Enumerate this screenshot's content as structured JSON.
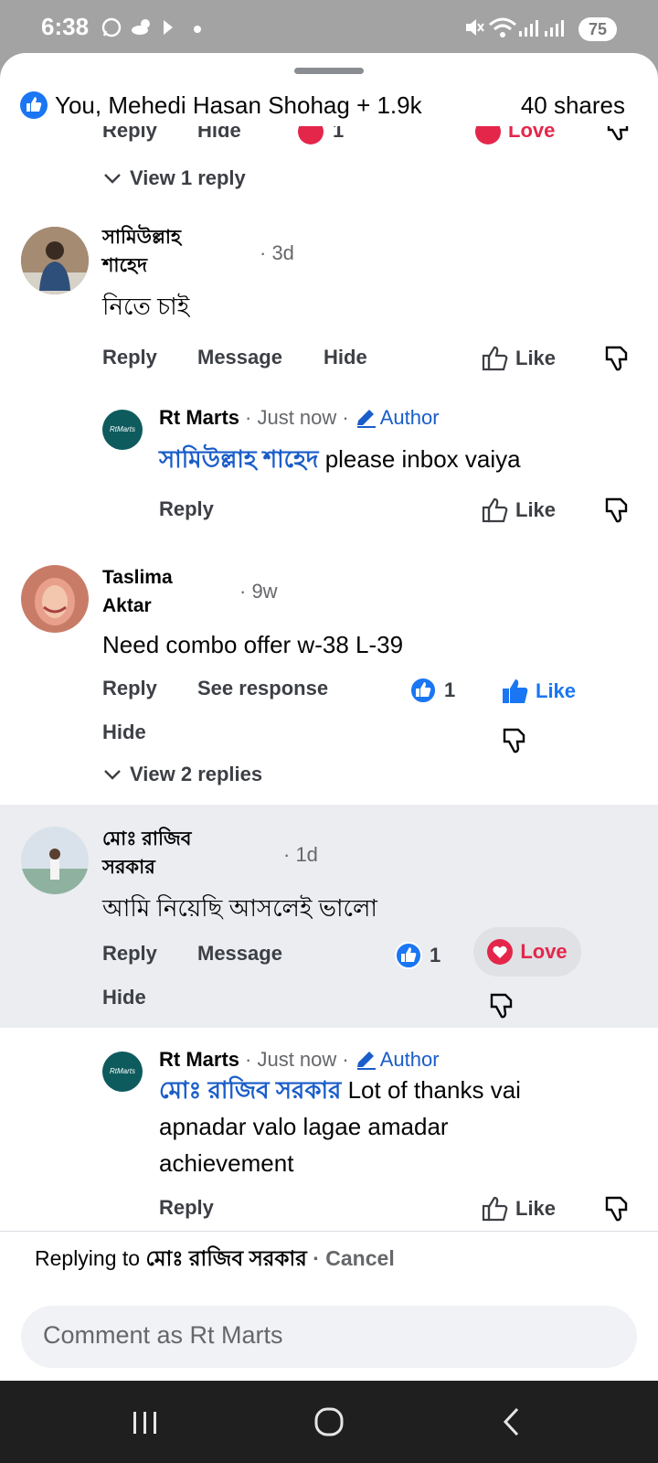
{
  "status": {
    "time": "6:38",
    "battery": "75"
  },
  "header": {
    "reactors": "You, Mehedi Hasan Shohag + 1.9k",
    "shares": "40 shares"
  },
  "partial_row": {
    "reply": "Reply",
    "hide": "Hide",
    "count": "1",
    "love": "Love"
  },
  "thread0": {
    "view_replies": "View 1 reply"
  },
  "comments": [
    {
      "name_line1": "সামিউল্লাহ",
      "name_line2": "শাহেদ",
      "time": "· 3d",
      "text": "নিতে চাই",
      "reply": "Reply",
      "message": "Message",
      "hide": "Hide",
      "like": "Like"
    },
    {
      "name_line1": "Taslima",
      "name_line2": "Aktar",
      "time": "· 9w",
      "text": "Need combo offer w-38 L-39",
      "reply": "Reply",
      "see_response": "See response",
      "hide": "Hide",
      "reaction_count": "1",
      "like": "Like",
      "view_replies": "View 2 replies"
    },
    {
      "name_line1": "মোঃ রাজিব",
      "name_line2": "সরকার",
      "time": "· 1d",
      "text": "আমি নিয়েছি  আসলেই ভালো",
      "reply": "Reply",
      "message": "Message",
      "hide": "Hide",
      "reaction_count": "1",
      "love": "Love"
    }
  ],
  "replies": [
    {
      "name": "Rt Marts",
      "time": "· Just now ·",
      "author": "Author",
      "mention": "সামিউল্লাহ শাহেদ",
      "text": "please inbox vaiya",
      "reply": "Reply",
      "like": "Like"
    },
    {
      "name": "Rt Marts",
      "time": "· Just now ·",
      "author": "Author",
      "mention": "মোঃ রাজিব সরকার",
      "text_line1": "Lot of thanks vai",
      "text_line2": "apnadar valo lagae amadar",
      "text_line3": "achievement",
      "reply": "Reply",
      "like": "Like"
    }
  ],
  "composer": {
    "replying_to": "Replying to",
    "target": "মোঃ রাজিব সরকার",
    "sep": " · ",
    "cancel": "Cancel",
    "placeholder": "Comment as Rt Marts"
  },
  "logo_text": "RtMarts",
  "icons": [
    "whatsapp-icon",
    "weather-icon",
    "arrow-icon",
    "mute-icon",
    "wifi-icon",
    "signal-icon",
    "like-icon",
    "dislike-icon",
    "love-icon",
    "pencil-icon",
    "chevron-down-icon",
    "recents-icon",
    "home-icon",
    "back-icon"
  ],
  "colors": {
    "accent": "#1a76f2",
    "love": "#e4264b",
    "highlight_bg": "#ebedf0"
  }
}
